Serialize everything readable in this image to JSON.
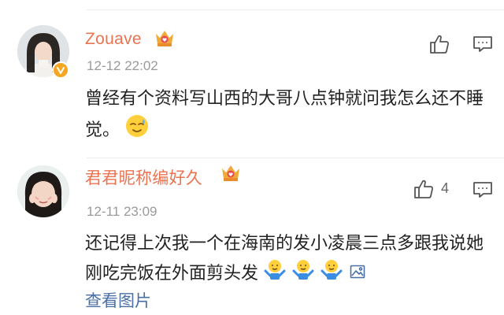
{
  "comments": [
    {
      "username": "Zouave",
      "time": "12-12 22:02",
      "text": "曾经有个资料写山西的大哥八点钟就问我怎么还不睡觉。",
      "like_count": "",
      "emoji": "sweat-smile-emoji",
      "verified": true
    },
    {
      "username": "君君昵称编好久",
      "time": "12-11 23:09",
      "text": "还记得上次我一个在海南的发小凌晨三点多跟我说她刚吃完饭在外面剪头发",
      "like_count": "4",
      "emoji": "shrug-emoji",
      "view_image": "查看图片"
    }
  ],
  "colors": {
    "username": "#eb7350",
    "time": "#9a9a9a",
    "link": "#4a6fa5",
    "crown": "#f0a93b",
    "verified": "#f5a623"
  }
}
